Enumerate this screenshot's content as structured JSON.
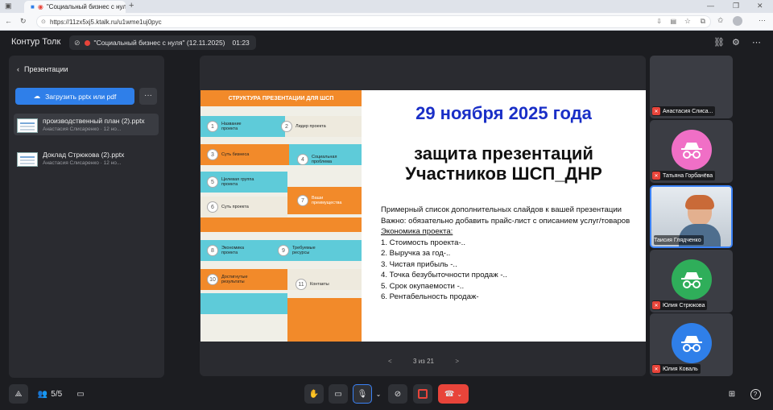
{
  "browser": {
    "tab_title": "\"Социальный бизнес с нул",
    "url": "https://11zx5xj5.ktalk.ru/u1wme1uj0pyc"
  },
  "header": {
    "brand": "Контур Толк",
    "meeting_title": "\"Социальный бизнес с нуля\" (12.11.2025)",
    "timer": "01:23"
  },
  "panel": {
    "title": "Презентации",
    "upload_label": "Загрузить pptx или pdf",
    "more_label": "···",
    "files": [
      {
        "name": "производственный план (2).pptx",
        "meta": "Анастасия Слисаренко · 12 но..."
      },
      {
        "name": "Доклад Стрюкова (2).pptx",
        "meta": "Анастасия Слисаренко · 12 но..."
      }
    ]
  },
  "slide": {
    "header": "СТРУКТУРА ПРЕЗЕНТАЦИИ ДЛЯ ШСП",
    "items": [
      {
        "n": "1",
        "label": "Название проекта"
      },
      {
        "n": "2",
        "label": "Лидер проекта"
      },
      {
        "n": "3",
        "label": "Суть бизнеса"
      },
      {
        "n": "4",
        "label": "Социальная проблема"
      },
      {
        "n": "5",
        "label": "Целевая группа проекта"
      },
      {
        "n": "6",
        "label": "Суть проекта"
      },
      {
        "n": "7",
        "label": "Ваши преимущества"
      },
      {
        "n": "8",
        "label": "Экономика проекта"
      },
      {
        "n": "9",
        "label": "Требуемые ресурсы"
      },
      {
        "n": "10",
        "label": "Достигнутые результаты"
      },
      {
        "n": "11",
        "label": "Контакты"
      }
    ],
    "date": "29 ноября 2025 года",
    "title_line1": "защита презентаций",
    "title_line2": "Участников ШСП_ДНР",
    "intro": "Примерный список дополнительных слайдов к вашей презентации",
    "important": "Важно: обязательно добавить прайс-лист с описанием услуг/товаров",
    "econ_heading": "Экономика проекта:",
    "econ_list": [
      "1. Стоимость проекта-..",
      "2. Выручка за год-..",
      "3. Чистая прибыль -..",
      "4. Точка безубыточности продаж -..",
      "5. Срок окупаемости -..",
      "6. Рентабельность продаж-"
    ]
  },
  "pager": {
    "label": "3 из 21",
    "prev": "<",
    "next": ">"
  },
  "participants": [
    {
      "name": "Анастасия Слиса...",
      "avatar": "none"
    },
    {
      "name": "Татьяна Горбанёва",
      "avatar_color": "#f06fc6"
    },
    {
      "name": "Таисия Глядченко",
      "avatar": "video"
    },
    {
      "name": "Юлия Стрюкова",
      "avatar_color": "#2fae5a"
    },
    {
      "name": "Юлия Коваль",
      "avatar_color": "#2f7fe9"
    }
  ],
  "toolbar": {
    "participants_count": "5/5"
  },
  "colors": {
    "accent": "#2f7fe9",
    "danger": "#e8443a",
    "slide_orange": "#f28a2a",
    "slide_teal": "#5ecbd9",
    "date_blue": "#1a2fc7"
  }
}
